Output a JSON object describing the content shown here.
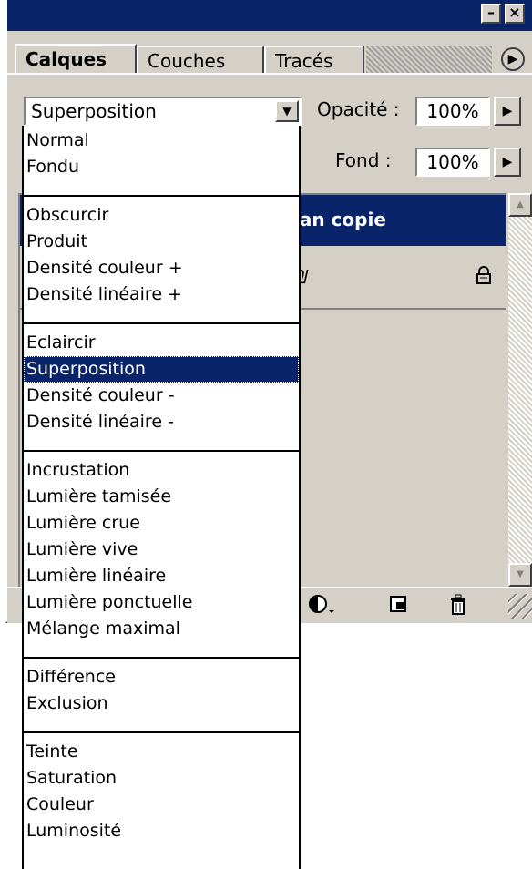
{
  "tabs": [
    "Calques",
    "Couches",
    "Tracés"
  ],
  "icons": {
    "minimize": "minimize-icon",
    "close": "close-icon",
    "panel_menu": "arrow-right-icon",
    "dropdown": "chevron-down-icon",
    "lock": "lock-icon",
    "adjustment": "half-circle-icon",
    "new_layer": "new-layer-icon",
    "trash": "trash-icon"
  },
  "blend_mode": {
    "selected": "Superposition"
  },
  "opacity": {
    "label": "Opacité :",
    "value": "100%"
  },
  "fill": {
    "label": "Fond :",
    "value": "100%"
  },
  "layers": {
    "selected_fragment": "lan copie",
    "row2_fragment": "₪"
  },
  "blend_groups": [
    [
      "Normal",
      "Fondu"
    ],
    [
      "Obscurcir",
      "Produit",
      "Densité couleur +",
      "Densité linéaire +"
    ],
    [
      "Eclaircir",
      "Superposition",
      "Densité couleur -",
      "Densité linéaire -"
    ],
    [
      "Incrustation",
      "Lumière tamisée",
      "Lumière crue",
      "Lumière vive",
      "Lumière linéaire",
      "Lumière ponctuelle",
      "Mélange maximal"
    ],
    [
      "Différence",
      "Exclusion"
    ],
    [
      "Teinte",
      "Saturation",
      "Couleur",
      "Luminosité"
    ]
  ],
  "colors": {
    "title_bar": "#0a246a",
    "selection": "#0a246a",
    "panel_bg": "#d4d0c8"
  }
}
